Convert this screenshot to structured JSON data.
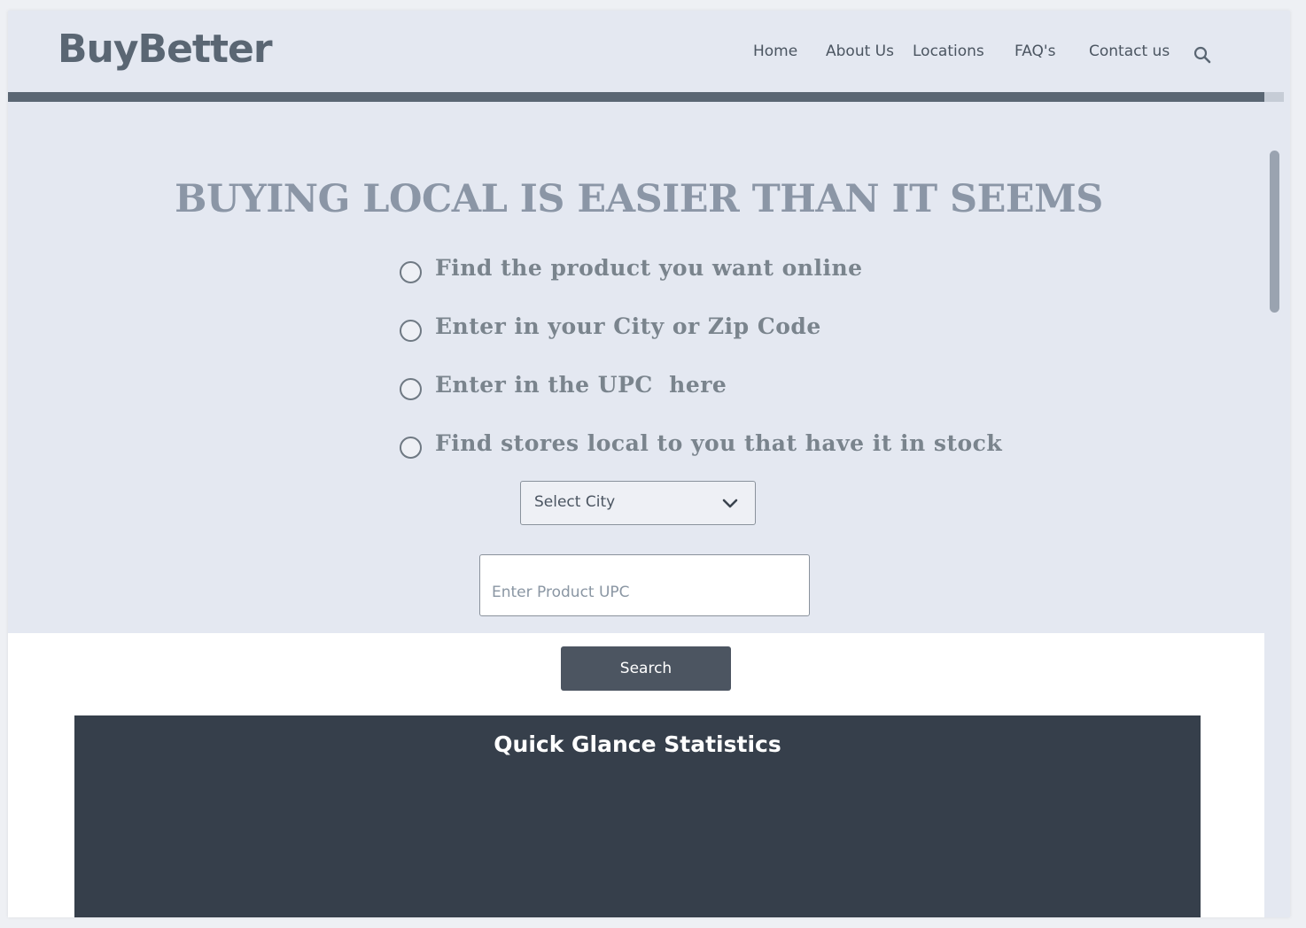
{
  "header": {
    "logo": "BuyBetter",
    "nav": [
      {
        "label": "Home"
      },
      {
        "label": "About Us"
      },
      {
        "label": "Locations"
      },
      {
        "label": "FAQ's"
      },
      {
        "label": "Contact us"
      }
    ],
    "search_icon": "search-icon"
  },
  "hero": {
    "title": "BUYING LOCAL IS EASIER THAN IT SEEMS",
    "steps": [
      {
        "label": "Find the product you want online"
      },
      {
        "label": "Enter in your City or Zip Code"
      },
      {
        "label": "Enter in the UPC  here"
      },
      {
        "label": "Find stores local to you that have it in stock"
      }
    ],
    "city_select": {
      "value": "Select City",
      "icon": "chevron-down-icon"
    },
    "upc_input": {
      "value": "",
      "placeholder": "Enter Product UPC"
    }
  },
  "search_button": {
    "label": "Search"
  },
  "stats": {
    "title": "Quick Glance Statistics"
  },
  "colors": {
    "background": "#e4e8f1",
    "accent_bar": "#5a6673",
    "hero_title": "#8b96a6",
    "button": "#4c5561",
    "stats_panel": "#363f4b"
  }
}
